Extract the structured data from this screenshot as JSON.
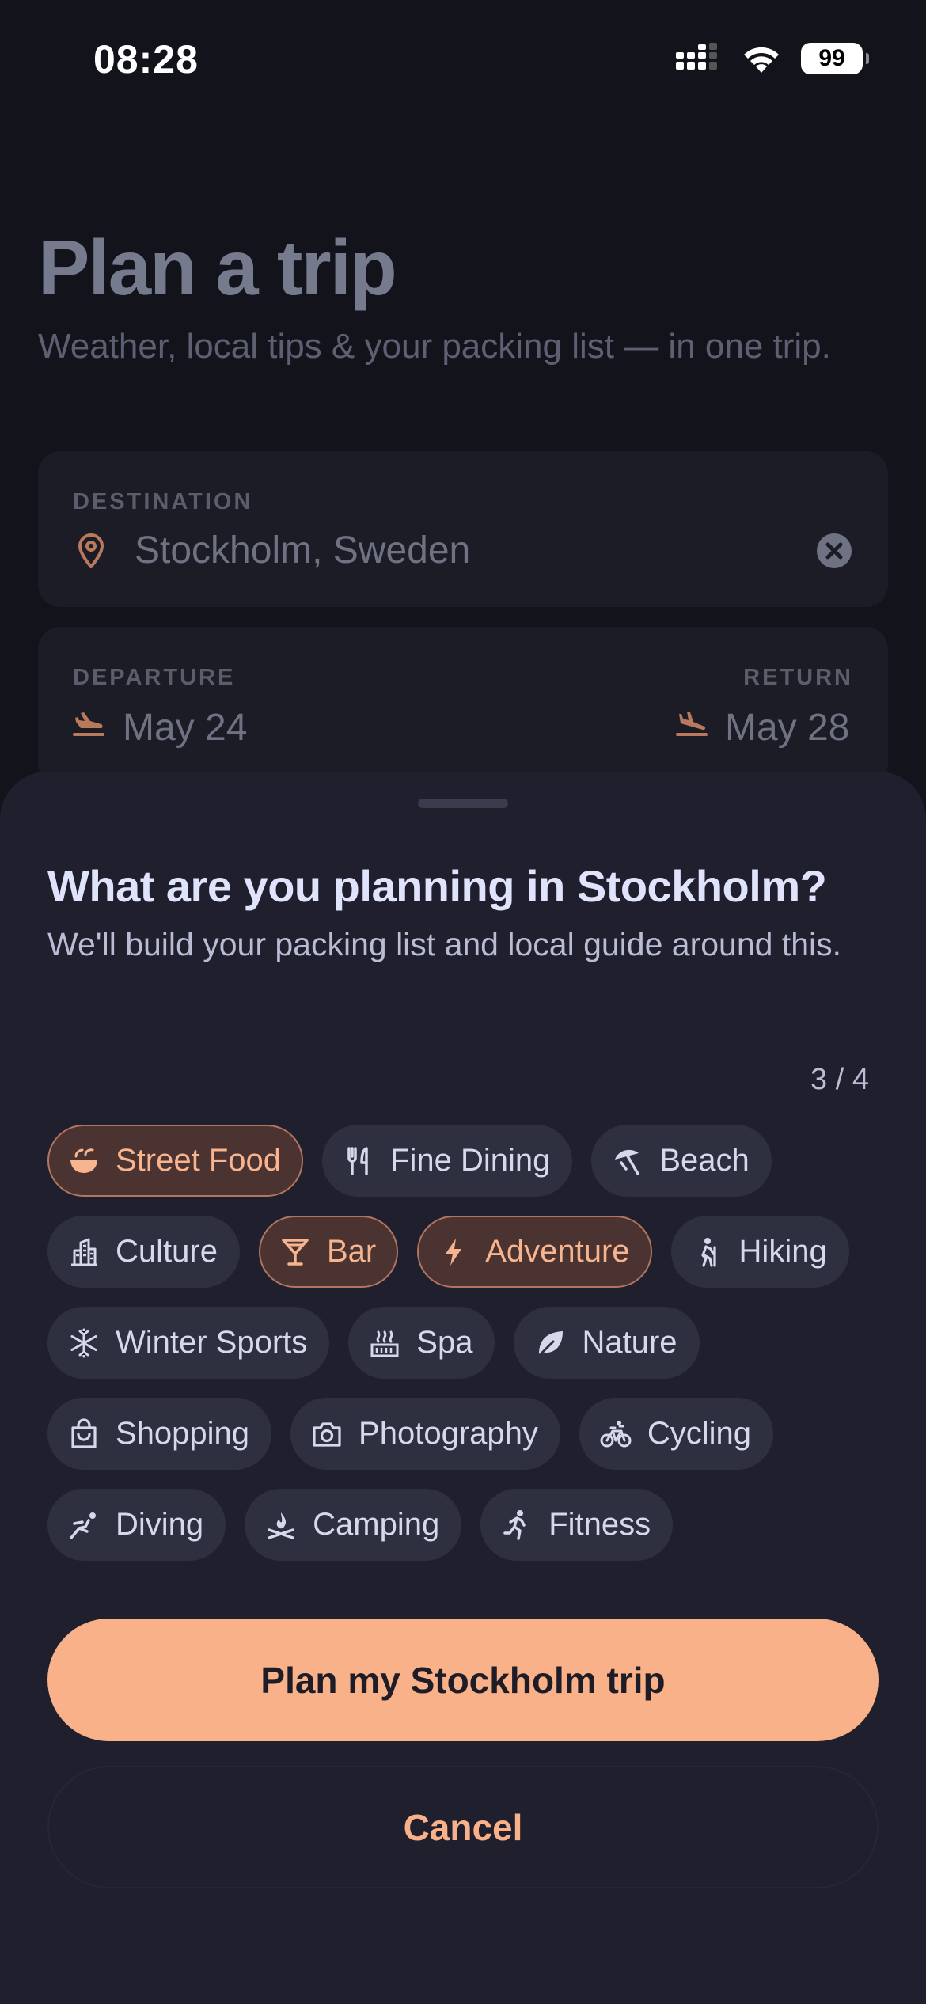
{
  "status_bar": {
    "time": "08:28",
    "battery": "99"
  },
  "page": {
    "title": "Plan a trip",
    "subtitle": "Weather, local tips & your packing list — in one trip.",
    "destination": {
      "label": "DESTINATION",
      "value": "Stockholm, Sweden"
    },
    "dates": {
      "departure_label": "DEPARTURE",
      "departure_value": "May 24",
      "return_label": "RETURN",
      "return_value": "May 28"
    }
  },
  "sheet": {
    "title": "What are you planning in Stockholm?",
    "subtitle": "We'll build your packing list and local guide around this.",
    "counter": "3 / 4",
    "chips": [
      {
        "label": "Street Food",
        "icon": "bowl-icon",
        "selected": true
      },
      {
        "label": "Fine Dining",
        "icon": "utensils-icon",
        "selected": false
      },
      {
        "label": "Beach",
        "icon": "umbrella-icon",
        "selected": false
      },
      {
        "label": "Culture",
        "icon": "building-icon",
        "selected": false
      },
      {
        "label": "Bar",
        "icon": "cocktail-icon",
        "selected": true
      },
      {
        "label": "Adventure",
        "icon": "bolt-icon",
        "selected": true
      },
      {
        "label": "Hiking",
        "icon": "hiker-icon",
        "selected": false
      },
      {
        "label": "Winter Sports",
        "icon": "snowflake-icon",
        "selected": false
      },
      {
        "label": "Spa",
        "icon": "hot-spring-icon",
        "selected": false
      },
      {
        "label": "Nature",
        "icon": "leaf-icon",
        "selected": false
      },
      {
        "label": "Shopping",
        "icon": "shopping-bag-icon",
        "selected": false
      },
      {
        "label": "Photography",
        "icon": "camera-icon",
        "selected": false
      },
      {
        "label": "Cycling",
        "icon": "bicycle-icon",
        "selected": false
      },
      {
        "label": "Diving",
        "icon": "swimmer-icon",
        "selected": false
      },
      {
        "label": "Camping",
        "icon": "campfire-icon",
        "selected": false
      },
      {
        "label": "Fitness",
        "icon": "runner-icon",
        "selected": false
      }
    ],
    "primary_button": "Plan my Stockholm trip",
    "secondary_button": "Cancel"
  },
  "colors": {
    "accent": "#f8b189",
    "selected_chip_bg": "#4a3330",
    "chip_bg": "#2e3040",
    "sheet_bg": "#1f1f2e",
    "page_bg": "#13131c"
  }
}
